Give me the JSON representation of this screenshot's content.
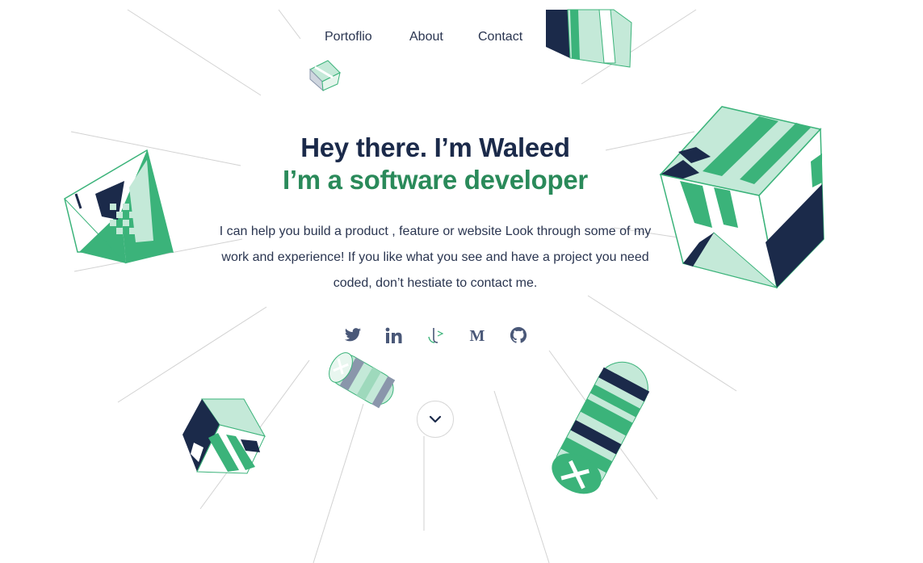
{
  "nav": {
    "items": [
      {
        "label": "Portoflio"
      },
      {
        "label": "About"
      },
      {
        "label": "Contact"
      }
    ]
  },
  "hero": {
    "greeting": "Hey there. I’m Waleed",
    "role": "I’m a software developer",
    "description": "I can help you build a product , feature or website Look through some of my work and experience! If you like what you see and have a project you need coded, don’t hestiate to contact me."
  },
  "social": {
    "icons": [
      "twitter-icon",
      "linkedin-icon",
      "upwork-icon",
      "medium-icon",
      "github-icon"
    ]
  },
  "scroll": {
    "icon": "chevron-down-icon"
  },
  "colors": {
    "navy": "#1b2a4a",
    "green": "#2a8a5a",
    "bright_green": "#3bb37a",
    "mint": "#c4e9d8",
    "icon_gray": "#4a5878"
  }
}
